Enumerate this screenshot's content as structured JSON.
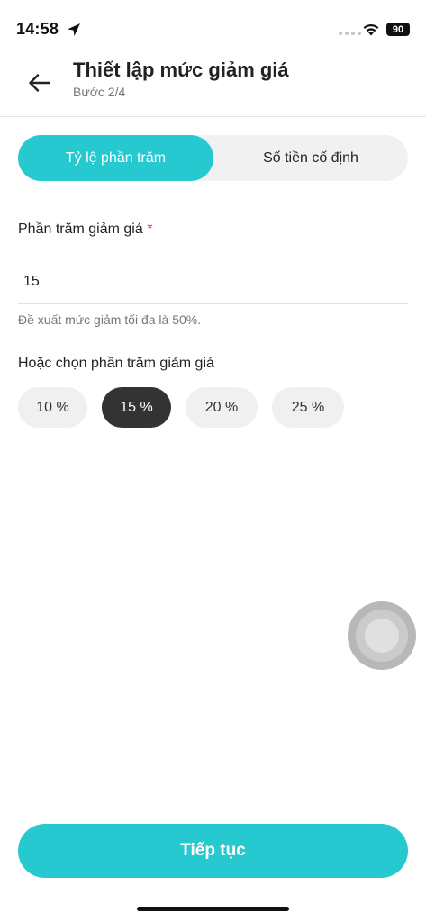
{
  "status_bar": {
    "time": "14:58",
    "battery": "90",
    "location_icon": "location-arrow-icon",
    "wifi_icon": "wifi-icon"
  },
  "header": {
    "back_icon": "arrow-left-icon",
    "title": "Thiết lập mức giảm giá",
    "subtitle": "Bước 2/4"
  },
  "segmented": {
    "options": [
      {
        "label": "Tỷ lệ phần trăm",
        "selected": true
      },
      {
        "label": "Số tiền cố định",
        "selected": false
      }
    ]
  },
  "discount_field": {
    "label": "Phần trăm giảm giá",
    "required_mark": "*",
    "value": "15",
    "hint": "Đề xuất mức giảm tối đa là 50%."
  },
  "preset": {
    "label": "Hoặc chọn phần trăm giảm giá",
    "options": [
      {
        "label": "10 %",
        "selected": false
      },
      {
        "label": "15 %",
        "selected": true
      },
      {
        "label": "20 %",
        "selected": false
      },
      {
        "label": "25 %",
        "selected": false
      }
    ]
  },
  "footer": {
    "continue_label": "Tiếp tục"
  },
  "colors": {
    "accent": "#27c9d1",
    "chip_selected": "#333333",
    "required": "#e53935"
  }
}
